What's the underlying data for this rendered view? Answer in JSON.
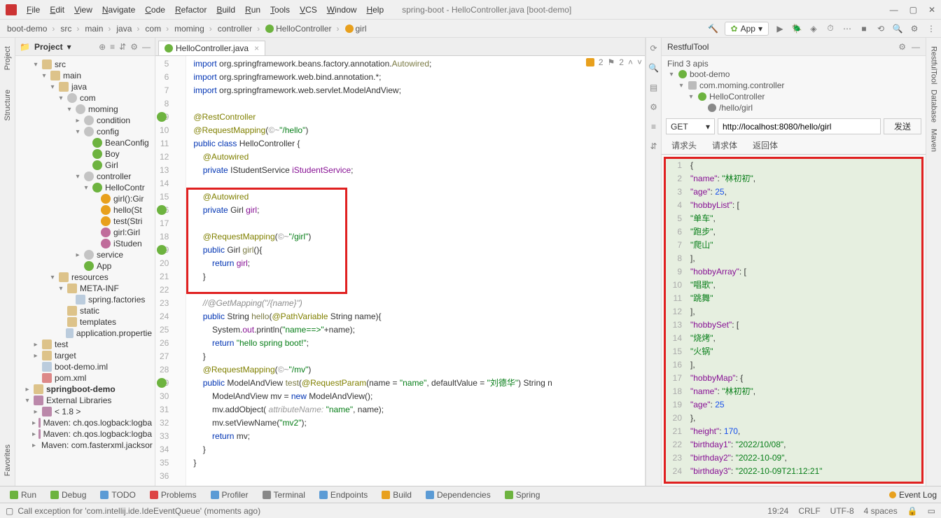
{
  "window": {
    "title": "spring-boot - HelloController.java [boot-demo]"
  },
  "menu": [
    "File",
    "Edit",
    "View",
    "Navigate",
    "Code",
    "Refactor",
    "Build",
    "Run",
    "Tools",
    "VCS",
    "Window",
    "Help"
  ],
  "breadcrumbs": [
    "boot-demo",
    "src",
    "main",
    "java",
    "com",
    "moming",
    "controller",
    "HelloController",
    "girl"
  ],
  "runConfig": "App",
  "projectTool": {
    "label": "Project"
  },
  "tree": [
    {
      "d": 2,
      "a": "▾",
      "i": "folder",
      "t": "src"
    },
    {
      "d": 3,
      "a": "▾",
      "i": "folder",
      "t": "main"
    },
    {
      "d": 4,
      "a": "▾",
      "i": "folder",
      "t": "java"
    },
    {
      "d": 5,
      "a": "▾",
      "i": "pkg",
      "t": "com"
    },
    {
      "d": 6,
      "a": "▾",
      "i": "pkg",
      "t": "moming"
    },
    {
      "d": 7,
      "a": "▸",
      "i": "pkg",
      "t": "condition"
    },
    {
      "d": 7,
      "a": "▾",
      "i": "pkg",
      "t": "config"
    },
    {
      "d": 8,
      "a": "",
      "i": "cls",
      "t": "BeanConfig"
    },
    {
      "d": 8,
      "a": "",
      "i": "cls",
      "t": "Boy"
    },
    {
      "d": 8,
      "a": "",
      "i": "cls",
      "t": "Girl"
    },
    {
      "d": 7,
      "a": "▾",
      "i": "pkg",
      "t": "controller"
    },
    {
      "d": 8,
      "a": "▾",
      "i": "cls",
      "t": "HelloContr"
    },
    {
      "d": 9,
      "a": "",
      "i": "m",
      "t": "girl():Gir"
    },
    {
      "d": 9,
      "a": "",
      "i": "m",
      "t": "hello(St"
    },
    {
      "d": 9,
      "a": "",
      "i": "m",
      "t": "test(Stri"
    },
    {
      "d": 9,
      "a": "",
      "i": "f",
      "t": "girl:Girl"
    },
    {
      "d": 9,
      "a": "",
      "i": "f",
      "t": "iStuden"
    },
    {
      "d": 7,
      "a": "▸",
      "i": "pkg",
      "t": "service"
    },
    {
      "d": 7,
      "a": "",
      "i": "cls",
      "t": "App"
    },
    {
      "d": 4,
      "a": "▾",
      "i": "folder",
      "t": "resources"
    },
    {
      "d": 5,
      "a": "▾",
      "i": "folder",
      "t": "META-INF"
    },
    {
      "d": 6,
      "a": "",
      "i": "file",
      "t": "spring.factories"
    },
    {
      "d": 5,
      "a": "",
      "i": "folder",
      "t": "static"
    },
    {
      "d": 5,
      "a": "",
      "i": "folder",
      "t": "templates"
    },
    {
      "d": 5,
      "a": "",
      "i": "file",
      "t": "application.propertie"
    },
    {
      "d": 2,
      "a": "▸",
      "i": "folder",
      "t": "test"
    },
    {
      "d": 2,
      "a": "▸",
      "i": "folder",
      "t": "target"
    },
    {
      "d": 2,
      "a": "",
      "i": "file",
      "t": "boot-demo.iml"
    },
    {
      "d": 2,
      "a": "",
      "i": "xml",
      "t": "pom.xml"
    },
    {
      "d": 1,
      "a": "▸",
      "i": "folder",
      "t": "springboot-demo",
      "b": true
    },
    {
      "d": 1,
      "a": "▾",
      "i": "lib",
      "t": "External Libraries"
    },
    {
      "d": 2,
      "a": "▸",
      "i": "lib",
      "t": "< 1.8 >"
    },
    {
      "d": 2,
      "a": "▸",
      "i": "lib",
      "t": "Maven: ch.qos.logback:logba"
    },
    {
      "d": 2,
      "a": "▸",
      "i": "lib",
      "t": "Maven: ch.qos.logback:logba"
    },
    {
      "d": 2,
      "a": "▸",
      "i": "lib",
      "t": "Maven: com.fasterxml.jacksor"
    }
  ],
  "tab": "HelloController.java",
  "warnings": {
    "yellow": "2",
    "gray": "2"
  },
  "code": {
    "startLine": 5,
    "lines": [
      {
        "html": "<span class='kw'>import</span> org.springframework.beans.factory.annotation.<span class='fn'>Autowired</span>;"
      },
      {
        "html": "<span class='kw'>import</span> org.springframework.web.bind.annotation.*;"
      },
      {
        "html": "<span class='kw'>import</span> org.springframework.web.servlet.ModelAndView;"
      },
      {
        "html": ""
      },
      {
        "html": "<span class='ann'>@RestController</span>",
        "gic": true
      },
      {
        "html": "<span class='ann'>@RequestMapping</span>(<span class='param'>©~</span><span class='str'>\"/hello\"</span>)"
      },
      {
        "html": "<span class='kw'>public class</span> HelloController {"
      },
      {
        "html": "    <span class='ann'>@Autowired</span>"
      },
      {
        "html": "    <span class='kw'>private</span> IStudentService <span class='fld'>iStudentService</span>;"
      },
      {
        "html": ""
      },
      {
        "html": "    <span class='ann'>@Autowired</span>"
      },
      {
        "html": "    <span class='kw'>private</span> Girl <span class='fld'>girl</span>;",
        "gic": true
      },
      {
        "html": ""
      },
      {
        "html": "    <span class='ann'>@RequestMapping</span>(<span class='param'>©~</span><span class='str'>\"/girl\"</span>)"
      },
      {
        "html": "    <span class='kw'>public</span> Girl <span class='fn'>girl</span>(){",
        "gic": true
      },
      {
        "html": "        <span class='kw'>return</span> <span class='fld'>girl</span>;"
      },
      {
        "html": "    }"
      },
      {
        "html": ""
      },
      {
        "html": "    <span class='cmt'>//@GetMapping(\"/{name}\")</span>"
      },
      {
        "html": "    <span class='kw'>public</span> String <span class='fn'>hello</span>(<span class='ann'>@PathVariable</span> String name){"
      },
      {
        "html": "        System.<span class='fld'>out</span>.println(<span class='str'>\"name==>\"</span>+name);"
      },
      {
        "html": "        <span class='kw'>return</span> <span class='str'>\"hello spring boot!\"</span>;"
      },
      {
        "html": "    }"
      },
      {
        "html": "    <span class='ann'>@RequestMapping</span>(<span class='param'>©~</span><span class='str'>\"/mv\"</span>)"
      },
      {
        "html": "    <span class='kw'>public</span> ModelAndView <span class='fn'>test</span>(<span class='ann'>@RequestParam</span>(name = <span class='str'>\"name\"</span>, defaultValue = <span class='str'>\"刘德华\"</span>) String n",
        "gic": true
      },
      {
        "html": "        ModelAndView mv = <span class='kw'>new</span> ModelAndView();"
      },
      {
        "html": "        mv.addObject( <span class='param'>attributeName:</span> <span class='str'>\"name\"</span>, name);"
      },
      {
        "html": "        mv.setViewName(<span class='str'>\"mv2\"</span>);"
      },
      {
        "html": "        <span class='kw'>return</span> mv;"
      },
      {
        "html": "    }"
      },
      {
        "html": "}"
      },
      {
        "html": ""
      }
    ]
  },
  "rest": {
    "title": "RestfulTool",
    "find": "Find 3 apis",
    "tree": [
      {
        "d": 0,
        "a": "▾",
        "i": "spring",
        "t": "boot-demo"
      },
      {
        "d": 1,
        "a": "▾",
        "i": "pkg",
        "t": "com.moming.controller"
      },
      {
        "d": 2,
        "a": "▾",
        "i": "cls",
        "t": "HelloController"
      },
      {
        "d": 3,
        "a": "",
        "i": "ep",
        "t": "/hello/girl"
      }
    ],
    "method": "GET",
    "url": "http://localhost:8080/hello/girl",
    "send": "发送",
    "tabs": [
      "请求头",
      "请求体",
      "返回体"
    ],
    "json": [
      "{",
      "  <span class='jsonkey'>\"name\"</span>: <span class='jsonstr'>\"林初初\"</span>,",
      "  <span class='jsonkey'>\"age\"</span>: <span class='jsonnum'>25</span>,",
      "  <span class='jsonkey'>\"hobbyList\"</span>: [",
      "    <span class='jsonstr'>\"单车\"</span>,",
      "    <span class='jsonstr'>\"跑步\"</span>,",
      "    <span class='jsonstr'>\"爬山\"</span>",
      "  ],",
      "  <span class='jsonkey'>\"hobbyArray\"</span>: [",
      "    <span class='jsonstr'>\"唱歌\"</span>,",
      "    <span class='jsonstr'>\"跳舞\"</span>",
      "  ],",
      "  <span class='jsonkey'>\"hobbySet\"</span>: [",
      "    <span class='jsonstr'>\"烧烤\"</span>,",
      "    <span class='jsonstr'>\"火锅\"</span>",
      "  ],",
      "  <span class='jsonkey'>\"hobbyMap\"</span>: {",
      "    <span class='jsonkey'>\"name\"</span>: <span class='jsonstr'>\"林初初\"</span>,",
      "    <span class='jsonkey'>\"age\"</span>: <span class='jsonnum'>25</span>",
      "  },",
      "  <span class='jsonkey'>\"height\"</span>: <span class='jsonnum'>170</span>,",
      "  <span class='jsonkey'>\"birthday1\"</span>: <span class='jsonstr'>\"2022/10/08\"</span>,",
      "  <span class='jsonkey'>\"birthday2\"</span>: <span class='jsonstr'>\"2022-10-09\"</span>,",
      "  <span class='jsonkey'>\"birthday3\"</span>: <span class='jsonstr'>\"2022-10-09T21:12:21\"</span>"
    ]
  },
  "bottomTabs": [
    {
      "i": "g",
      "t": "Run"
    },
    {
      "i": "g",
      "t": "Debug"
    },
    {
      "i": "b",
      "t": "TODO"
    },
    {
      "i": "r",
      "t": "Problems"
    },
    {
      "i": "b",
      "t": "Profiler"
    },
    {
      "i": "",
      "t": "Terminal"
    },
    {
      "i": "b",
      "t": "Endpoints"
    },
    {
      "i": "y",
      "t": "Build"
    },
    {
      "i": "b",
      "t": "Dependencies"
    },
    {
      "i": "g",
      "t": "Spring"
    }
  ],
  "eventLog": "Event Log",
  "status": {
    "msg": "Call exception for 'com.intellij.ide.IdeEventQueue' (moments ago)",
    "time": "19:24",
    "eol": "CRLF",
    "enc": "UTF-8",
    "indent": "4 spaces"
  }
}
